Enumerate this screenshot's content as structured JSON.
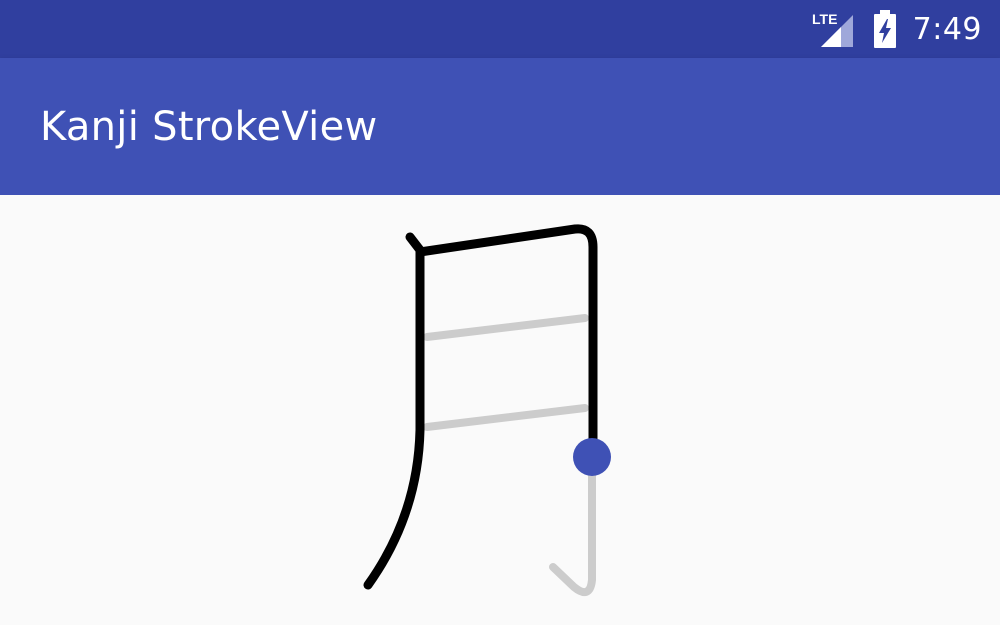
{
  "status_bar": {
    "network_label": "LTE",
    "time": "7:49"
  },
  "app_bar": {
    "title": "Kanji StrokeView"
  },
  "stroke_view": {
    "character": "月",
    "total_strokes": 4,
    "completed_strokes": 1,
    "current_stroke": 2,
    "colors": {
      "drawn": "#000000",
      "pending": "#cccccc",
      "cursor": "#3f51b5"
    }
  },
  "colors": {
    "status_bar": "#303f9f",
    "app_bar": "#3f51b5",
    "background": "#fafafa"
  }
}
